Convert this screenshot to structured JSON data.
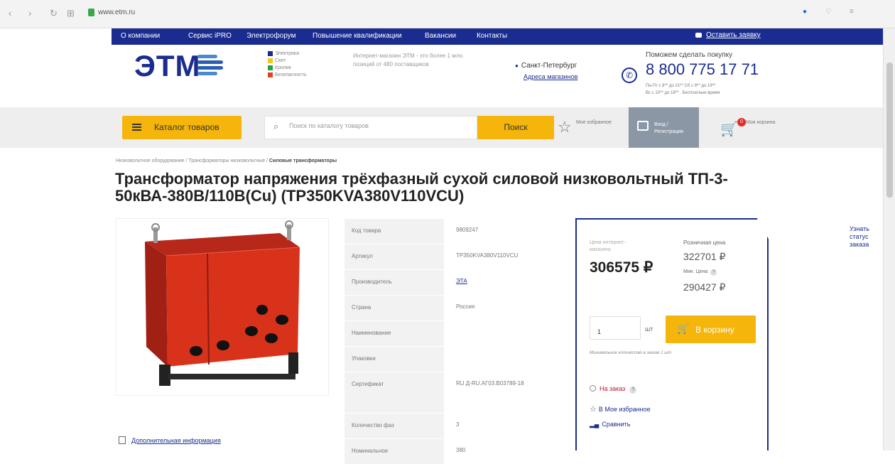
{
  "browser": {
    "domain": "www.etm.ru"
  },
  "topnav": {
    "items": [
      "О компании",
      "Сервис iPRO",
      "Электрофорум",
      "Повышение квалификации",
      "Вакансии",
      "Контакты"
    ],
    "order": "Оставить заявку"
  },
  "header": {
    "logo": "ЭТМ",
    "categories": [
      "Электрика",
      "Свет",
      "Кролик",
      "Безопасность"
    ],
    "description": "Интернет-магазин ЭТМ - это более 1 млн. позиций от 480 поставщиков",
    "city": "Санкт-Петербург",
    "stores_link": "Адреса магазинов",
    "help": "Поможем сделать покупку",
    "phone": "8 800 775 17 71",
    "hours": [
      "Пн-Пт с 8⁰⁰ до 21⁰⁰ Сб с 9⁰⁰ до 19⁰⁰",
      "Вс с 10⁰⁰ до 18⁰⁰ . Бесплатные время"
    ]
  },
  "catbar": {
    "catalog": "Каталог товаров",
    "search_placeholder": "Поиск по каталогу товаров",
    "search_btn": "Поиск",
    "favorites": "Мое избранное",
    "login": "Вход / Регистрация",
    "cart": "Моя корзина",
    "cart_count": "0"
  },
  "breadcrumb": {
    "trail": "Низковольтное оборудование / Трансформаторы низковольтные / ",
    "current": "Силовые трансформаторы"
  },
  "product": {
    "title": "Трансформатор напряжения трёхфазный сухой силовой низковольтный ТП-3-50кВА-380В/110В(Cu) (TP350KVA380V110VCU)",
    "specs": [
      {
        "key": "Код товара",
        "value": "9809247"
      },
      {
        "key": "Артикул",
        "value": "TP350KVA380V110VCU"
      },
      {
        "key": "Производитель",
        "value": "ЭТА"
      },
      {
        "key": "Страна",
        "value": "Россия"
      },
      {
        "key": "Наименование",
        "value": ""
      },
      {
        "key": "Упаковки",
        "value": ""
      },
      {
        "key": "Сертификат",
        "value": "RU Д-RU.АГ03.В03789-18"
      },
      {
        "key": "Количество фаз",
        "value": "3"
      },
      {
        "key": "Номинальное",
        "value": "380"
      }
    ],
    "extra_info": "Дополнительная информация"
  },
  "buybox": {
    "price_label": "Цена интернет-магазина",
    "price": "306575 ₽",
    "retail_label": "Розничная цена",
    "retail": "322701 ₽",
    "min_label": "Мин. Цена",
    "min": "290427 ₽",
    "qty": "1",
    "unit": "шт",
    "to_cart": "В корзину",
    "min_order": "Минимальное количество в заказе 1 шт",
    "status": "На заказ",
    "add_fav": "В Мое избранное",
    "compare": "Сравнить"
  },
  "side": {
    "order_status": "Узнать статус заказа"
  },
  "colors": {
    "brand": "#1a2c8f",
    "accent": "#f5b50a",
    "transformer": "#d8321a"
  }
}
